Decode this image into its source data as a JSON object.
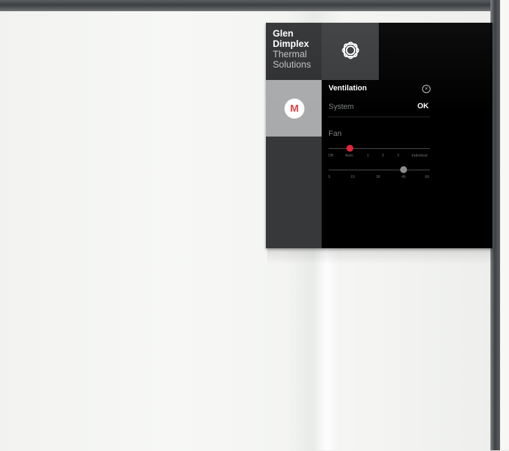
{
  "brand": {
    "line1": "Glen",
    "line2": "Dimplex",
    "line3": "Thermal",
    "line4": "Solutions",
    "logo_icon": "celtic-knot-icon"
  },
  "mode": {
    "letter": "M",
    "letter_color": "#d64545"
  },
  "ventilation": {
    "title": "Ventilation",
    "close_icon": "close-circle-icon",
    "system_label": "System",
    "system_value": "OK"
  },
  "fan": {
    "label": "Fan",
    "mode_slider": {
      "options": [
        "Off",
        "Auto",
        "1",
        "2",
        "3",
        "Individual"
      ],
      "selected": "Auto",
      "knob_color": "#e0263a"
    },
    "time_slider": {
      "options": [
        "5",
        "15",
        "30",
        "45",
        "60"
      ],
      "selected": "45",
      "knob_color": "#8a8c8e"
    }
  }
}
